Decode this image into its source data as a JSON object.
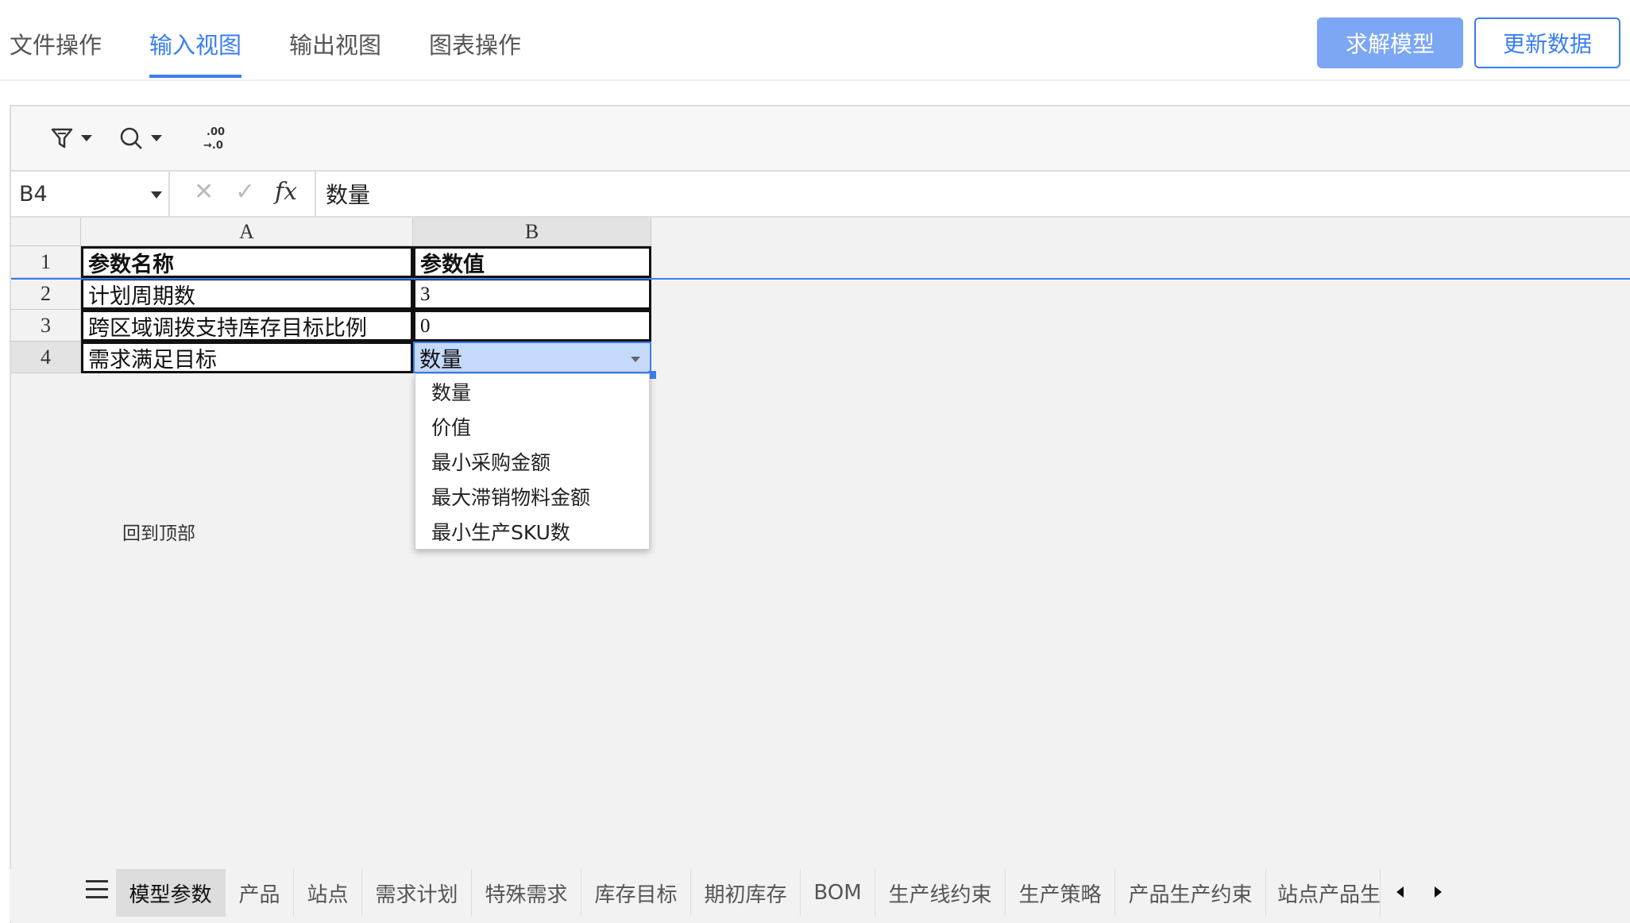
{
  "topnav": {
    "tabs": [
      {
        "label": "文件操作"
      },
      {
        "label": "输入视图"
      },
      {
        "label": "输出视图"
      },
      {
        "label": "图表操作"
      }
    ],
    "solve_label": "求解模型",
    "update_label": "更新数据"
  },
  "formula_bar": {
    "cell_ref": "B4",
    "fx": "fx",
    "value": "数量"
  },
  "toolbar": {
    "decimal_label": ".00\n→.0"
  },
  "grid": {
    "columns": [
      "A",
      "B"
    ],
    "rows": [
      {
        "num": "1",
        "a": "参数名称",
        "b": "参数值"
      },
      {
        "num": "2",
        "a": "计划周期数",
        "b": "3"
      },
      {
        "num": "3",
        "a": "跨区域调拨支持库存目标比例",
        "b": "0"
      },
      {
        "num": "4",
        "a": "需求满足目标",
        "b": "数量"
      }
    ]
  },
  "dropdown": {
    "options": [
      "数量",
      "价值",
      "最小采购金额",
      "最大滞销物料金额",
      "最小生产SKU数"
    ]
  },
  "back_to_top": "回到顶部",
  "sheet_tabs": [
    "模型参数",
    "产品",
    "站点",
    "需求计划",
    "特殊需求",
    "库存目标",
    "期初库存",
    "BOM",
    "生产线约束",
    "生产策略",
    "产品生产约束",
    "站点产品生"
  ],
  "colors": {
    "accent": "#3a7ff0",
    "primary_button": "#7ba7f4"
  }
}
